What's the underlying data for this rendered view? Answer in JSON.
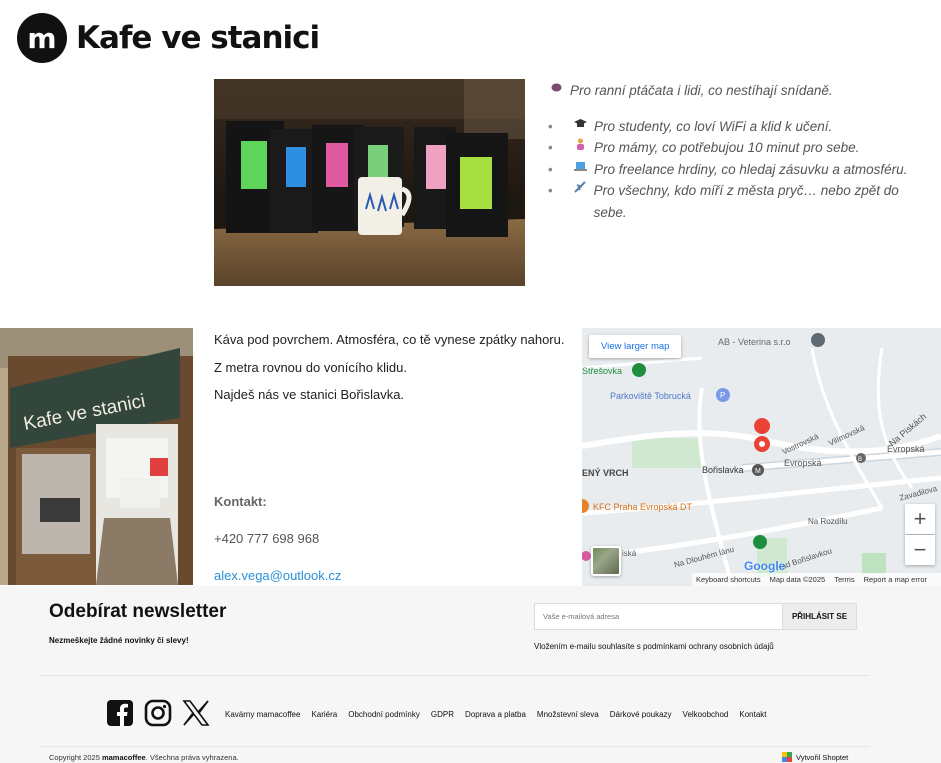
{
  "header": {
    "logo_letter": "m",
    "brand": "Kafe ve stanici"
  },
  "audience": {
    "lead": "Pro ranní ptáčata i lidi, co nestíhají snídaně.",
    "items": [
      "Pro studenty, co loví WiFi a klid k učení.",
      "Pro mámy, co potřebujou 10 minut pro sebe.",
      "Pro freelance hrdiny, co hledaj zásuvku a atmosféru.",
      "Pro všechny, kdo míří z města pryč… nebo zpět do sebe."
    ],
    "icons": [
      "coffee-bean",
      "graduation-cap",
      "mother",
      "laptop",
      "airplane"
    ]
  },
  "storefront": {
    "sign": "Kafe ve stanici"
  },
  "info": {
    "line1": "Káva pod povrchem. Atmosféra, co tě vynese zpátky nahoru.",
    "line2": "Z metra rovnou do vonícího klidu.",
    "line3": "Najdeš nás ve stanici Bořislavka.",
    "contact_title": "Kontakt:",
    "phone": "+420 777 698 968",
    "email": "alex.vega@outlook.cz"
  },
  "map": {
    "view_larger": "View larger map",
    "zoom_in": "+",
    "zoom_out": "−",
    "labels": {
      "vet": "AB - Veterina s.r.o",
      "stresovka": "Střešovka",
      "parking": "Parkoviště Tobrucká",
      "vrch": "ENÝ VRCH",
      "station": "Bořislavka",
      "station_badge": "M",
      "kfc": "KFC Praha Evropská DT",
      "evropska1": "Evropská",
      "evropska2": "Evropská",
      "vostrovska": "Vostrovská",
      "vilimovska": "Vilímovská",
      "piskach": "Na Piskách",
      "zavadilova": "Zavadilova",
      "rozdilu": "Na Rozdílu",
      "dlouhem": "Na Dlouhém lánu",
      "nad_borislavkou": "Nad Bořislavkou",
      "iska": "iská",
      "parking_badge": "P",
      "bus_badge": "B",
      "google": "Google"
    },
    "footer": [
      "Keyboard shortcuts",
      "Map data ©2025",
      "Terms",
      "Report a map error"
    ]
  },
  "newsletter": {
    "title": "Odebírat newsletter",
    "subtitle": "Nezmeškejte žádné novinky či slevy!",
    "placeholder": "Vaše e-mailová adresa",
    "button": "PŘIHLÁSIT SE",
    "consent": "Vložením e-mailu souhlasíte s podmínkami ochrany osobních údajů"
  },
  "footer": {
    "social": [
      "facebook-icon",
      "instagram-icon",
      "x-icon"
    ],
    "links": [
      "Kavárny mamacoffee",
      "Kariéra",
      "Obchodní podmínky",
      "GDPR",
      "Doprava a platba",
      "Množstevní sleva",
      "Dárkové poukazy",
      "Velkoobchod",
      "Kontakt"
    ],
    "copyright_prefix": "Copyright 2025 ",
    "copyright_brand": "mamacoffee",
    "copyright_suffix": ". Všechna práva vyhrazena.",
    "created_by": "Vytvořil Shoptet"
  },
  "colors": {
    "link": "#2b8fd8",
    "map_blue": "#1a73e8",
    "station_green": "#1e8e3e",
    "pin_red": "#ea4335"
  }
}
